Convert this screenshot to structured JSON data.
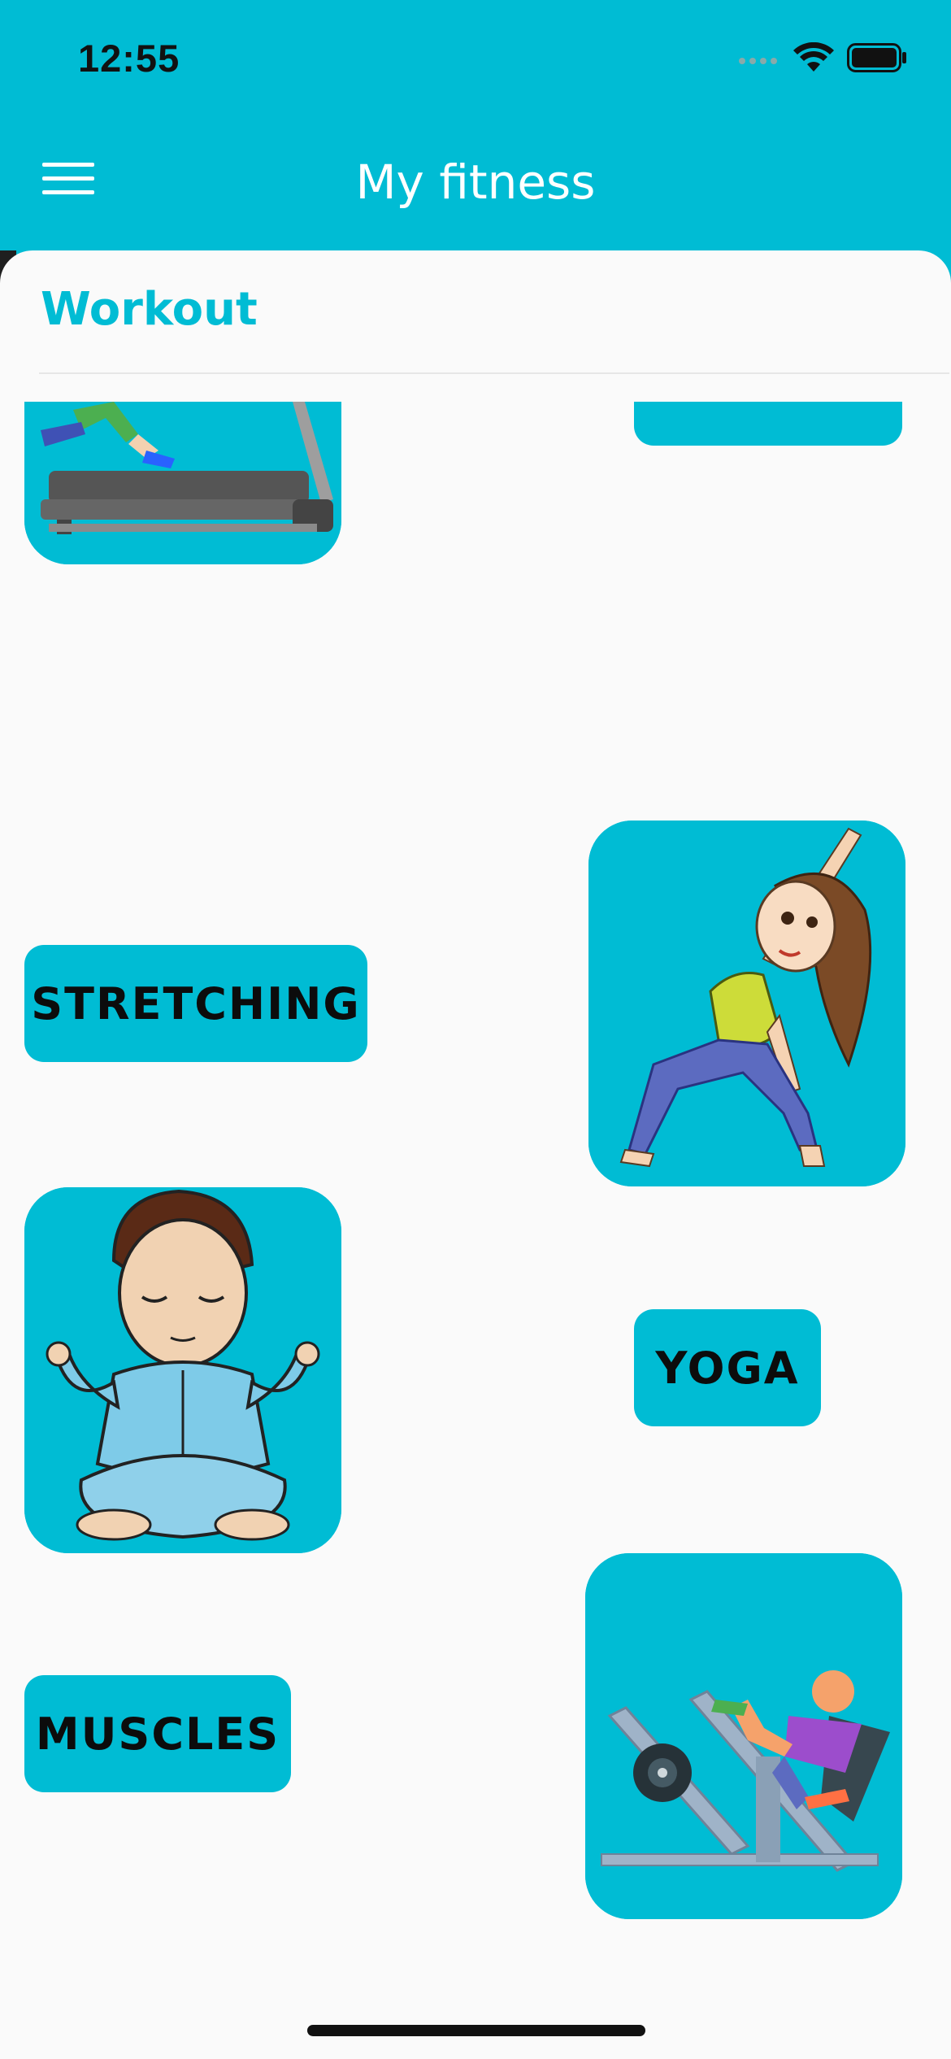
{
  "status_bar": {
    "time": "12:55",
    "icons": [
      "cellular-signal-icon",
      "wifi-icon",
      "battery-icon"
    ]
  },
  "app_bar": {
    "title": "My fitness",
    "menu_icon": "hamburger-menu-icon"
  },
  "section": {
    "title": "Workout"
  },
  "workouts": [
    {
      "label": "STRETCHING",
      "image": "treadmill-runner-illustration"
    },
    {
      "label": "YOGA",
      "image": "stretching-girl-illustration"
    },
    {
      "label": "MUSCLES",
      "image": "meditating-man-illustration"
    },
    {
      "label": "",
      "image": "leg-press-machine-illustration"
    }
  ],
  "colors": {
    "accent": "#00bcd4",
    "background": "#fafafa",
    "label_text": "#0c0c0c"
  }
}
